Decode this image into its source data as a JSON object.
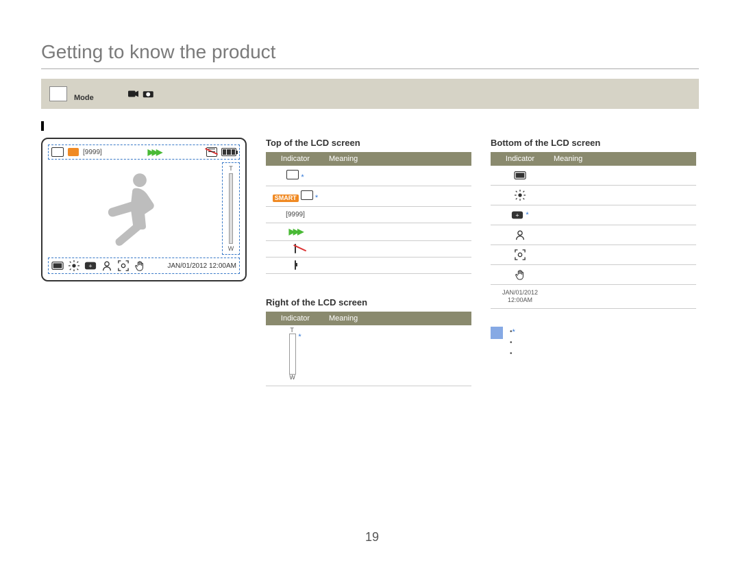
{
  "page_title": "Getting to know the product",
  "section_label": "",
  "mode_banner": {
    "line1": "",
    "line2_prefix": "Mode",
    "right_text": ""
  },
  "lcd": {
    "counter_box": "[9999]",
    "zoom_t": "T",
    "zoom_w": "W",
    "timestamp": "JAN/01/2012 12:00AM"
  },
  "tables": {
    "header_indicator": "Indicator",
    "header_meaning": "Meaning",
    "top": {
      "title": "Top of the LCD screen",
      "rows": [
        {
          "icon_name": "sd-card-icon",
          "meaning": "",
          "star": true,
          "html": "card"
        },
        {
          "icon_name": "smart-icon",
          "meaning": "",
          "star": true,
          "html": "smart"
        },
        {
          "icon_name": "counter-icon",
          "label": "[9999]",
          "meaning": "",
          "html": "text"
        },
        {
          "icon_name": "burst-icon",
          "meaning": "",
          "html": "burst"
        },
        {
          "icon_name": "card-missing-icon",
          "meaning": "",
          "html": "card-slash"
        },
        {
          "icon_name": "battery-icon",
          "meaning": "",
          "html": "battery"
        }
      ]
    },
    "right": {
      "title": "Right of the LCD screen",
      "rows": [
        {
          "icon_name": "zoom-bar-icon",
          "meaning": "",
          "star": true,
          "html": "zoom"
        }
      ]
    },
    "bottom": {
      "title": "Bottom of the LCD screen",
      "rows": [
        {
          "icon_name": "display-icon",
          "meaning": "",
          "html": "rect"
        },
        {
          "icon_name": "light-icon",
          "meaning": "",
          "html": "sun"
        },
        {
          "icon_name": "ev-icon",
          "meaning": "",
          "star": true,
          "html": "plus"
        },
        {
          "icon_name": "face-icon",
          "meaning": "",
          "html": "face"
        },
        {
          "icon_name": "focus-icon",
          "meaning": "",
          "html": "focus"
        },
        {
          "icon_name": "anti-shake-icon",
          "meaning": "",
          "html": "hand"
        },
        {
          "icon_name": "datetime-icon",
          "label": "JAN/01/2012 12:00AM",
          "meaning": "",
          "html": "text"
        }
      ]
    }
  },
  "note": {
    "star_marker": "*",
    "lines": [
      "",
      "",
      ""
    ]
  },
  "page_number": "19"
}
